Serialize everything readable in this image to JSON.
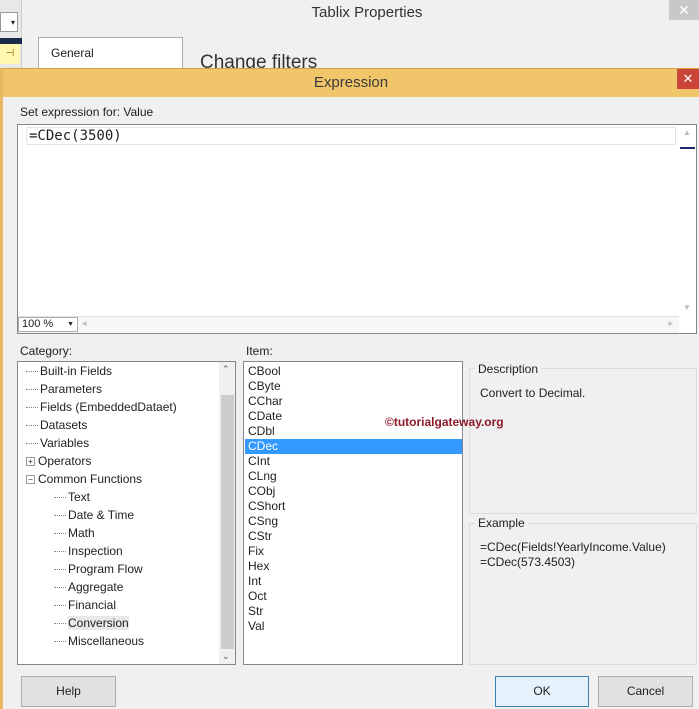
{
  "background_window": {
    "title": "Tablix Properties",
    "close": "✕",
    "tab_general": "General",
    "heading": "Change filters",
    "pin": "⊣"
  },
  "dialog": {
    "title": "Expression",
    "close": "✕",
    "set_expression_label": "Set expression for: Value",
    "expression": "=CDec(3500)",
    "zoom": "100 %",
    "category_label": "Category:",
    "item_label": "Item:",
    "categories": [
      {
        "label": "Built-in Fields",
        "level": 0
      },
      {
        "label": "Parameters",
        "level": 0
      },
      {
        "label": "Fields (EmbeddedDataet)",
        "level": 0
      },
      {
        "label": "Datasets",
        "level": 0
      },
      {
        "label": "Variables",
        "level": 0
      },
      {
        "label": "Operators",
        "level": 0,
        "toggle": "+"
      },
      {
        "label": "Common Functions",
        "level": 0,
        "toggle": "−"
      },
      {
        "label": "Text",
        "level": 1
      },
      {
        "label": "Date & Time",
        "level": 1
      },
      {
        "label": "Math",
        "level": 1
      },
      {
        "label": "Inspection",
        "level": 1
      },
      {
        "label": "Program Flow",
        "level": 1
      },
      {
        "label": "Aggregate",
        "level": 1
      },
      {
        "label": "Financial",
        "level": 1
      },
      {
        "label": "Conversion",
        "level": 1,
        "selected": true
      },
      {
        "label": "Miscellaneous",
        "level": 1
      }
    ],
    "items": [
      "CBool",
      "CByte",
      "CChar",
      "CDate",
      "CDbl",
      "CDec",
      "CInt",
      "CLng",
      "CObj",
      "CShort",
      "CSng",
      "CStr",
      "Fix",
      "Hex",
      "Int",
      "Oct",
      "Str",
      "Val"
    ],
    "selected_item": "CDec",
    "description_label": "Description",
    "description": "Convert to Decimal.",
    "example_label": "Example",
    "examples": [
      "=CDec(Fields!YearlyIncome.Value)",
      "=CDec(573.4503)"
    ],
    "watermark": "©tutorialgateway.org",
    "buttons": {
      "help": "Help",
      "ok": "OK",
      "cancel": "Cancel"
    }
  },
  "colors": {
    "title_bar": "#f1c66a",
    "selection": "#3399ff",
    "close": "#c9453a"
  }
}
